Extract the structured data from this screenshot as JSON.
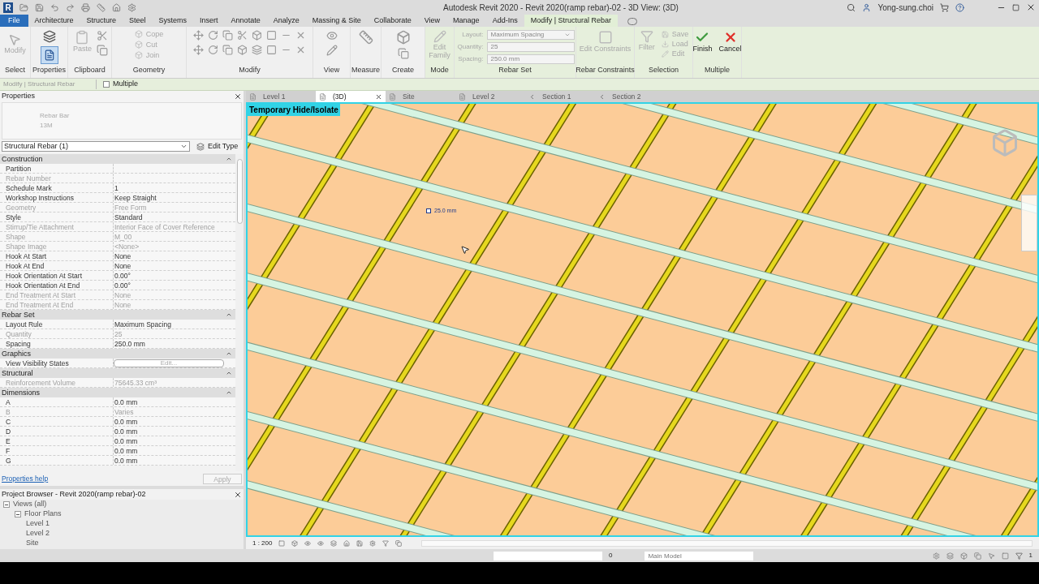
{
  "window": {
    "logo": "R",
    "title": "Autodesk Revit 2020 - Revit 2020(ramp rebar)-02 - 3D View: (3D)",
    "user": "Yong-sung.choi"
  },
  "menu_tabs": [
    {
      "label": "File",
      "kind": "file",
      "selected": false
    },
    {
      "label": "Architecture",
      "kind": "tab",
      "selected": false
    },
    {
      "label": "Structure",
      "kind": "tab",
      "selected": false
    },
    {
      "label": "Steel",
      "kind": "tab",
      "selected": false
    },
    {
      "label": "Systems",
      "kind": "tab",
      "selected": false
    },
    {
      "label": "Insert",
      "kind": "tab",
      "selected": false
    },
    {
      "label": "Annotate",
      "kind": "tab",
      "selected": false
    },
    {
      "label": "Analyze",
      "kind": "tab",
      "selected": false
    },
    {
      "label": "Massing & Site",
      "kind": "tab",
      "selected": false
    },
    {
      "label": "Collaborate",
      "kind": "tab",
      "selected": false
    },
    {
      "label": "View",
      "kind": "tab",
      "selected": false
    },
    {
      "label": "Manage",
      "kind": "tab",
      "selected": false
    },
    {
      "label": "Add-Ins",
      "kind": "tab",
      "selected": false
    },
    {
      "label": "Modify | Structural Rebar",
      "kind": "tab",
      "selected": true
    }
  ],
  "ribbon": {
    "panels": [
      {
        "label": "Select",
        "buttons": [
          {
            "label": "Modify",
            "disabled": true
          }
        ]
      },
      {
        "label": "Properties",
        "active": true
      },
      {
        "label": "Clipboard",
        "buttons": [
          {
            "label": "Paste",
            "disabled": true
          }
        ]
      },
      {
        "label": "Geometry",
        "buttons": [
          {
            "label": "Cope",
            "disabled": true
          },
          {
            "label": "Cut",
            "disabled": true
          },
          {
            "label": "Join",
            "disabled": true
          }
        ]
      },
      {
        "label": "Modify"
      },
      {
        "label": "View"
      },
      {
        "label": "Measure"
      },
      {
        "label": "Create"
      },
      {
        "label": "Mode",
        "buttons": [
          {
            "label": "Edit Family",
            "disabled": true
          }
        ]
      },
      {
        "label": "Rebar Set"
      },
      {
        "label": "Rebar Constraints",
        "buttons": [
          {
            "label": "Edit Constraints",
            "disabled": true
          }
        ]
      },
      {
        "label": "Selection",
        "buttons": [
          {
            "label": "Filter",
            "disabled": true
          },
          {
            "label": "Save",
            "disabled": true
          },
          {
            "label": "Load",
            "disabled": true
          },
          {
            "label": "Edit",
            "disabled": true
          }
        ]
      },
      {
        "label": "Multiple",
        "buttons": [
          {
            "label": "Finish",
            "disabled": false
          },
          {
            "label": "Cancel",
            "disabled": false
          }
        ]
      }
    ],
    "rebar_set": {
      "layout_label": "Layout:",
      "layout": "Maximum Spacing",
      "quantity_label": "Quantity:",
      "quantity": "25",
      "spacing_label": "Spacing:",
      "spacing": "250.0 mm"
    }
  },
  "options_bar": {
    "context": "Modify | Structural Rebar",
    "multiple": {
      "label": "Multiple",
      "checked": false
    }
  },
  "properties": {
    "title": "Properties",
    "type_name": "Rebar Bar",
    "type_size": "13M",
    "selector": "Structural Rebar (1)",
    "edit_type": "Edit Type",
    "groups": [
      {
        "name": "Construction",
        "rows": [
          {
            "label": "Partition",
            "value": "",
            "disabled": false,
            "kind": "text"
          },
          {
            "label": "Rebar Number",
            "value": "",
            "disabled": true,
            "kind": "text"
          },
          {
            "label": "Schedule Mark",
            "value": "1",
            "disabled": false,
            "kind": "text"
          },
          {
            "label": "Workshop Instructions",
            "value": "Keep Straight",
            "disabled": false,
            "kind": "text"
          },
          {
            "label": "Geometry",
            "value": "Free Form",
            "disabled": true,
            "kind": "text"
          },
          {
            "label": "Style",
            "value": "Standard",
            "disabled": false,
            "kind": "text"
          },
          {
            "label": "Stirrup/Tie Attachment",
            "value": "Interior Face of Cover Reference",
            "disabled": true,
            "kind": "text"
          },
          {
            "label": "Shape",
            "value": "M_00",
            "disabled": true,
            "kind": "text"
          },
          {
            "label": "Shape Image",
            "value": "<None>",
            "disabled": true,
            "kind": "text"
          },
          {
            "label": "Hook At Start",
            "value": "None",
            "disabled": false,
            "kind": "text"
          },
          {
            "label": "Hook At End",
            "value": "None",
            "disabled": false,
            "kind": "text"
          },
          {
            "label": "Hook Orientation At Start",
            "value": "0.00°",
            "disabled": false,
            "kind": "text"
          },
          {
            "label": "Hook Orientation At End",
            "value": "0.00°",
            "disabled": false,
            "kind": "text"
          },
          {
            "label": "End Treatment At Start",
            "value": "None",
            "disabled": true,
            "kind": "text"
          },
          {
            "label": "End Treatment At End",
            "value": "None",
            "disabled": true,
            "kind": "text"
          }
        ]
      },
      {
        "name": "Rebar Set",
        "rows": [
          {
            "label": "Layout Rule",
            "value": "Maximum Spacing",
            "disabled": false,
            "kind": "text"
          },
          {
            "label": "Quantity",
            "value": "25",
            "disabled": true,
            "kind": "text"
          },
          {
            "label": "Spacing",
            "value": "250.0 mm",
            "disabled": false,
            "kind": "text"
          }
        ]
      },
      {
        "name": "Graphics",
        "rows": [
          {
            "label": "View Visibility States",
            "value": "Edit...",
            "disabled": false,
            "kind": "button"
          }
        ]
      },
      {
        "name": "Structural",
        "rows": [
          {
            "label": "Reinforcement Volume",
            "value": "75645.33 cm³",
            "disabled": true,
            "kind": "text"
          }
        ]
      },
      {
        "name": "Dimensions",
        "rows": [
          {
            "label": "A",
            "value": "0.0 mm",
            "disabled": false,
            "kind": "text"
          },
          {
            "label": "B",
            "value": "Varies",
            "disabled": true,
            "kind": "text"
          },
          {
            "label": "C",
            "value": "0.0 mm",
            "disabled": false,
            "kind": "text"
          },
          {
            "label": "D",
            "value": "0.0 mm",
            "disabled": false,
            "kind": "text"
          },
          {
            "label": "E",
            "value": "0.0 mm",
            "disabled": false,
            "kind": "text"
          },
          {
            "label": "F",
            "value": "0.0 mm",
            "disabled": false,
            "kind": "text"
          },
          {
            "label": "G",
            "value": "0.0 mm",
            "disabled": false,
            "kind": "text"
          }
        ]
      }
    ],
    "help": "Properties help",
    "apply": "Apply"
  },
  "project_browser": {
    "title": "Project Browser - Revit 2020(ramp rebar)-02",
    "tree": [
      {
        "label": "Views (all)",
        "expanded": true,
        "children": [
          {
            "label": "Floor Plans",
            "expanded": true,
            "children": [
              {
                "label": "Level 1"
              },
              {
                "label": "Level 2"
              },
              {
                "label": "Site"
              }
            ]
          }
        ]
      }
    ]
  },
  "view_tabs": [
    {
      "label": "Level 1",
      "kind": "plan",
      "selected": false
    },
    {
      "label": "(3D)",
      "kind": "model",
      "selected": true
    },
    {
      "label": "Site",
      "kind": "plan",
      "selected": false
    },
    {
      "label": "Level 2",
      "kind": "plan",
      "selected": false
    },
    {
      "label": "Section 1",
      "kind": "section",
      "selected": false
    },
    {
      "label": "Section 2",
      "kind": "section",
      "selected": false
    }
  ],
  "viewport": {
    "banner": "Temporary Hide/Isolate",
    "dimension": "25.0 mm",
    "scale": "1 : 200"
  },
  "status_bar": {
    "worksets": "0",
    "model": "Main Model",
    "filter_count": "1"
  }
}
